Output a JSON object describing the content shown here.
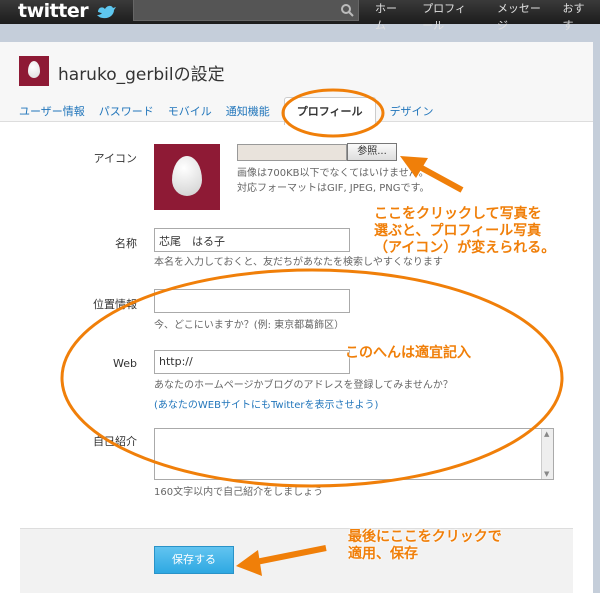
{
  "topbar": {
    "logo": "twitter",
    "search_placeholder": "",
    "nav": [
      "ホーム",
      "プロフィール",
      "メッセージ",
      "おすす"
    ]
  },
  "header": {
    "title": "haruko_gerbilの設定",
    "tabs": [
      "ユーザー情報",
      "パスワード",
      "モバイル",
      "通知機能",
      "プロフィール",
      "デザイン"
    ],
    "active_tab": "プロフィール"
  },
  "form": {
    "icon": {
      "label": "アイコン",
      "browse_label": "参照...",
      "help": "画像は700KB以下でなくてはいけません。対応フォーマットはGIF, JPEG, PNGです。"
    },
    "name": {
      "label": "名称",
      "value": "芯尾　はる子",
      "help": "本名を入力しておくと、友だちがあなたを検索しやすくなります"
    },
    "location": {
      "label": "位置情報",
      "value": "",
      "help": "今、どこにいますか？(例: 東京都葛飾区）"
    },
    "web": {
      "label": "Web",
      "value": "http://",
      "help": "あなたのホームページかブログのアドレスを登録してみませんか？",
      "link": "(あなたのWEBサイトにもTwitterを表示させよう)"
    },
    "bio": {
      "label": "自己紹介",
      "value": "",
      "help": "160文字以内で自己紹介をしましょう"
    },
    "save_label": "保存する"
  },
  "annotations": {
    "photo": "ここをクリックして写真を\n選ぶと、プロフィール写真\n（アイコン）が変えられる。",
    "fields": "このへんは適宜記入",
    "save": "最後にここをクリックで\n適用、保存"
  },
  "colors": {
    "accent_orange": "#f07f09",
    "link_blue": "#2276bb",
    "avatar_bg": "#8e1a35",
    "save_button": "#2ea8e2"
  }
}
